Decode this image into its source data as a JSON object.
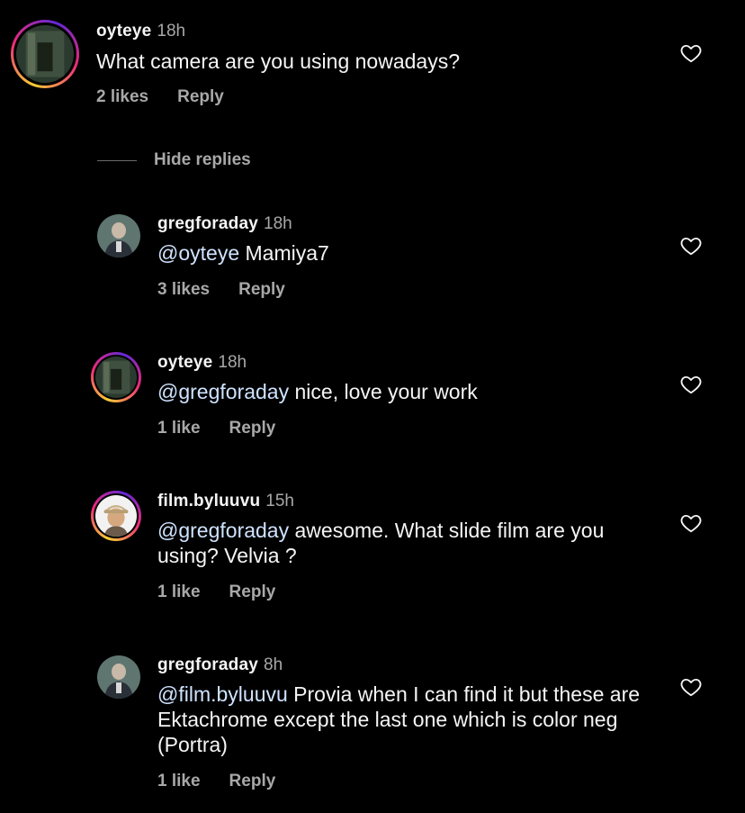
{
  "comments": [
    {
      "username": "oyteye",
      "time": "18h",
      "mention": "",
      "text": "What camera are you using nowadays?",
      "likes": "2 likes",
      "reply": "Reply"
    },
    {
      "username": "gregforaday",
      "time": "18h",
      "mention": "@oyteye",
      "text": " Mamiya7",
      "likes": "3 likes",
      "reply": "Reply"
    },
    {
      "username": "oyteye",
      "time": "18h",
      "mention": "@gregforaday",
      "text": " nice, love your work",
      "likes": "1 like",
      "reply": "Reply"
    },
    {
      "username": "film.byluuvu",
      "time": "15h",
      "mention": "@gregforaday",
      "text": " awesome. What slide film are you using?  Velvia ?",
      "likes": "1 like",
      "reply": "Reply"
    },
    {
      "username": "gregforaday",
      "time": "8h",
      "mention": "@film.byluuvu",
      "text": " Provia when I can find it but these are Ektachrome except the last one which is color neg (Portra)",
      "likes": "1 like",
      "reply": "Reply"
    }
  ],
  "hide_replies": "Hide replies",
  "icons": {
    "like": "heart-outline-icon"
  },
  "colors": {
    "background": "#000000",
    "muted": "#a8a8a8",
    "mention": "#cfe3ff"
  }
}
